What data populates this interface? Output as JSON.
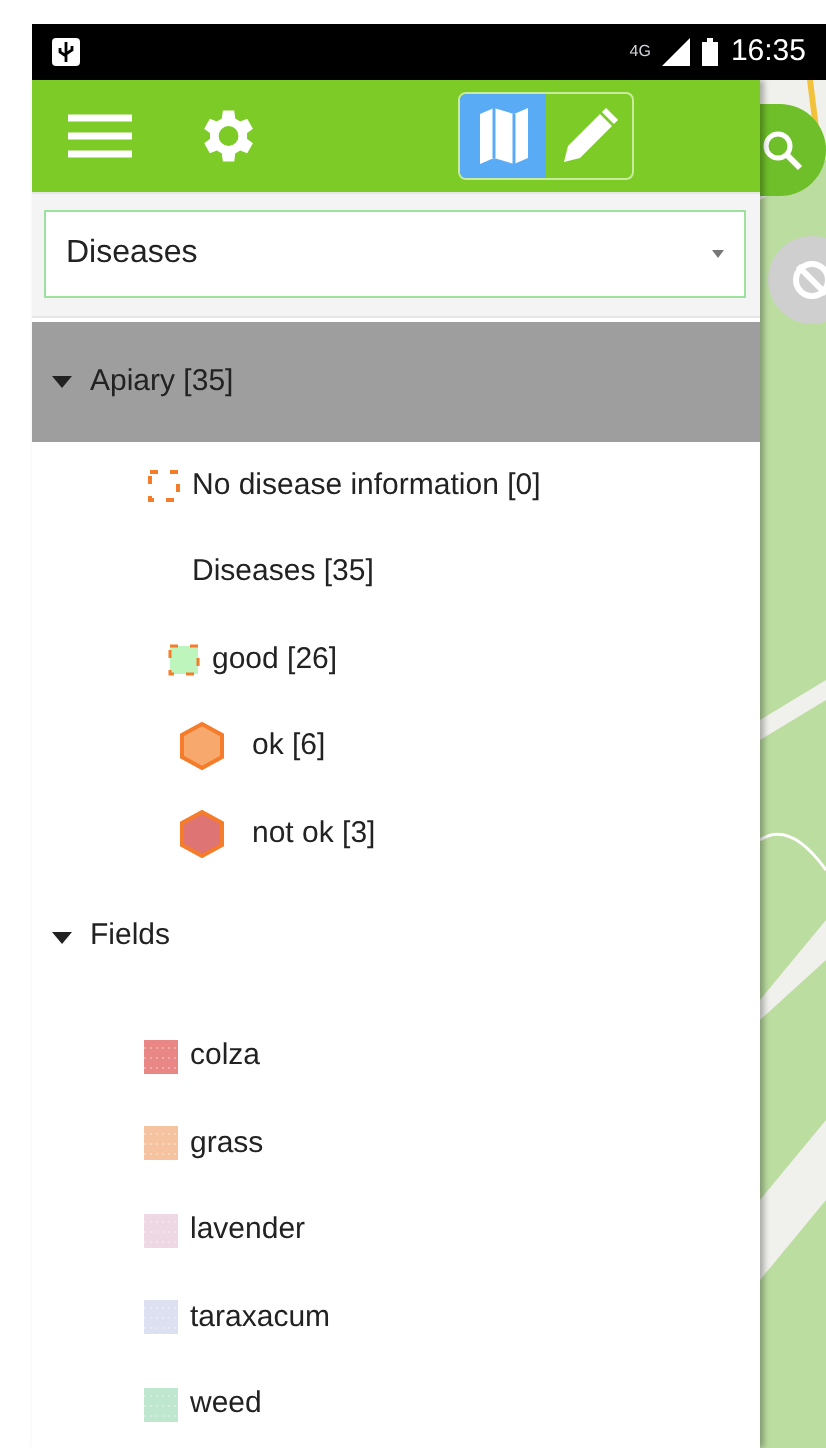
{
  "status_bar": {
    "network": "4G",
    "time": "16:35"
  },
  "toolbar": {
    "mode_toggle": [
      {
        "kind": "map",
        "selected": true
      },
      {
        "kind": "edit",
        "selected": false
      }
    ]
  },
  "layer_dropdown": {
    "value": "Diseases"
  },
  "groups": [
    {
      "label": "Apiary [35]",
      "expanded": true,
      "selected": true,
      "items": [
        {
          "label": "No disease information [0]",
          "kind": "outline"
        },
        {
          "label": "Diseases [35]",
          "kind": "none"
        },
        {
          "label": "good [26]",
          "kind": "square",
          "color": "#bdf5bd"
        },
        {
          "label": "ok [6]",
          "kind": "hexagon",
          "color": "#f7a86c"
        },
        {
          "label": "not ok [3]",
          "kind": "hexagon",
          "color": "#df7474"
        }
      ]
    },
    {
      "label": "Fields",
      "expanded": true,
      "selected": false,
      "items": [
        {
          "label": "colza",
          "kind": "swatch",
          "color": "#e98686"
        },
        {
          "label": "grass",
          "kind": "swatch",
          "color": "#f6c3a0"
        },
        {
          "label": "lavender",
          "kind": "swatch",
          "color": "#eed8e3"
        },
        {
          "label": "taraxacum",
          "kind": "swatch",
          "color": "#dde0f0"
        },
        {
          "label": "weed",
          "kind": "swatch",
          "color": "#bfe6cf"
        }
      ]
    }
  ]
}
